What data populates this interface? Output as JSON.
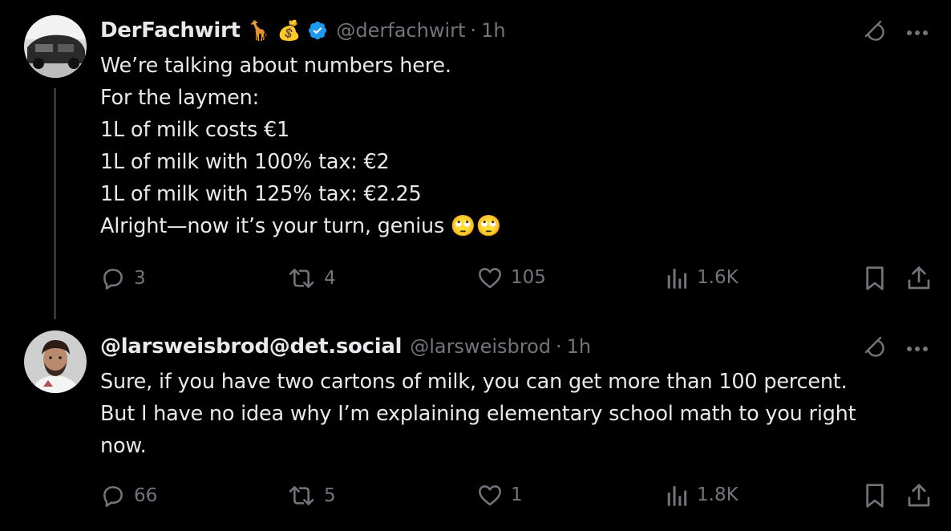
{
  "tweets": [
    {
      "display_name": "DerFachwirt",
      "name_emojis": [
        "🦒",
        "💰"
      ],
      "handle": "@derfachwirt",
      "separator": "·",
      "time": "1h",
      "body_lines": [
        "We’re talking about numbers here.",
        "For the laymen:",
        "1L of milk costs €1",
        "1L of milk with 100% tax: €2",
        "1L of milk with 125% tax: €2.25",
        "Alright—now it’s your turn, genius 🙄🙄"
      ],
      "replies": "3",
      "reposts": "4",
      "likes": "105",
      "views": "1.6K"
    },
    {
      "display_name": "@larsweisbrod@det.social",
      "handle": "@larsweisbrod",
      "separator": "·",
      "time": "1h",
      "body_lines": [
        "Sure, if you have two cartons of milk, you can get more than 100 percent.",
        "But I have no idea why I’m explaining elementary school math to you right",
        "now."
      ],
      "replies": "66",
      "reposts": "5",
      "likes": "1",
      "views": "1.8K"
    }
  ],
  "colors": {
    "background": "#000000",
    "text": "#e7e9ea",
    "muted": "#71767b",
    "verified": "#1d9bf0",
    "thread_line": "#333639"
  },
  "icons": [
    "grok-icon",
    "more-icon",
    "reply-icon",
    "repost-icon",
    "like-icon",
    "views-icon",
    "bookmark-icon",
    "share-icon",
    "verified-badge-icon"
  ]
}
